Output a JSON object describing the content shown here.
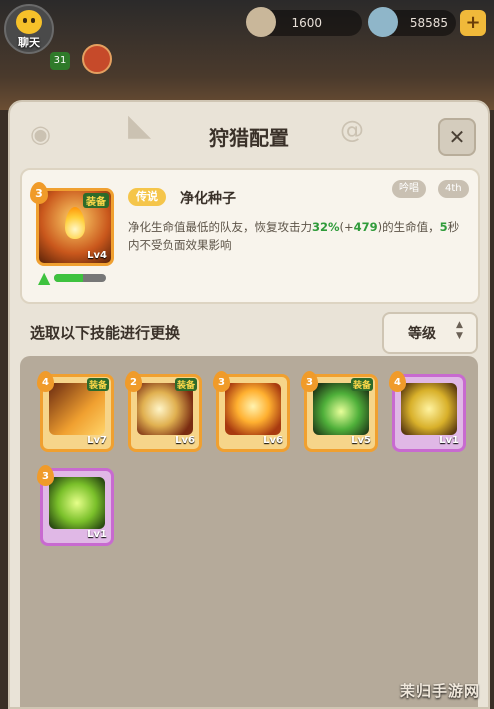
{
  "hud": {
    "chat_label": "聊天",
    "player_level": "31",
    "resource1_value": "1600",
    "resource2_value": "58585",
    "plus": "+"
  },
  "panel": {
    "title": "狩猎配置",
    "close": "✕"
  },
  "selected_skill": {
    "rank": "3",
    "equip_label": "装备",
    "level": "Lv4",
    "upgrade_progress": 0.55,
    "rarity": "传说",
    "name": "净化种子",
    "tag1": "吟唱",
    "tag2": "4th",
    "desc_part1": "净化生命值最低的队友，恢复攻击力",
    "desc_hl1": "32%",
    "desc_part2": "(+",
    "desc_hl2": "479",
    "desc_part3": ")的生命值，",
    "desc_hl3": "5",
    "desc_part4": "秒内不受负面效果影响"
  },
  "replace": {
    "label": "选取以下技能进行更换",
    "sort_label": "等级"
  },
  "skills": [
    {
      "rank": "4",
      "level": "Lv7",
      "equip": "装备",
      "border": "#f0a030",
      "art": "feather"
    },
    {
      "rank": "2",
      "level": "Lv6",
      "equip": "装备",
      "border": "#f0a030",
      "art": "swirl"
    },
    {
      "rank": "3",
      "level": "Lv6",
      "equip": "",
      "border": "#f0a030",
      "art": "flame"
    },
    {
      "rank": "3",
      "level": "Lv5",
      "equip": "装备",
      "border": "#f0a030",
      "art": "heal"
    },
    {
      "rank": "4",
      "level": "Lv1",
      "equip": "",
      "border": "#c86ad0",
      "art": "robot"
    },
    {
      "rank": "3",
      "level": "Lv1",
      "equip": "",
      "border": "#c86ad0",
      "art": "green-figure"
    }
  ],
  "watermark": "茉归手游网"
}
